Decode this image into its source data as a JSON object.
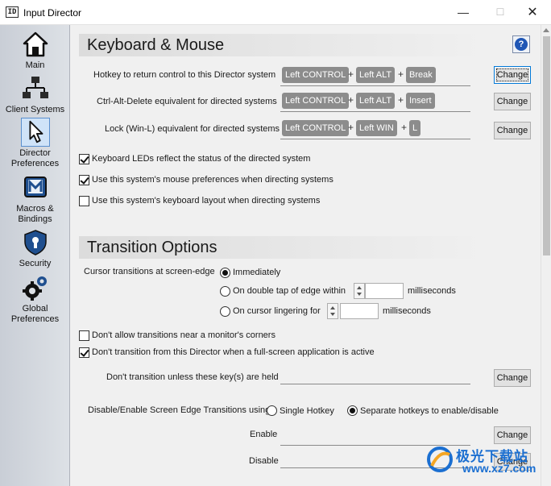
{
  "window": {
    "icon_text": "ID",
    "title": "Input Director",
    "minimize_glyph": "—",
    "maximize_glyph": "☐",
    "close_glyph": "✕"
  },
  "sidebar": {
    "items": [
      {
        "label": "Main",
        "icon": "house-icon"
      },
      {
        "label": "Client Systems",
        "icon": "network-icon"
      },
      {
        "label": "Director Preferences",
        "icon": "cursor-arrow-icon",
        "selected": true
      },
      {
        "label": "Macros & Bindings",
        "icon": "macro-m-icon"
      },
      {
        "label": "Security",
        "icon": "shield-keyhole-icon"
      },
      {
        "label": "Global Preferences",
        "icon": "gears-icon"
      }
    ]
  },
  "keyboard_mouse": {
    "title": "Keyboard & Mouse",
    "help_glyph": "?",
    "hotkey_rows": [
      {
        "label": "Hotkey to return control to this Director system",
        "keys": [
          "Left CONTROL",
          "Left ALT",
          "Break"
        ],
        "button": "Change"
      },
      {
        "label": "Ctrl-Alt-Delete equivalent for directed systems",
        "keys": [
          "Left CONTROL",
          "Left ALT",
          "Insert"
        ],
        "button": "Change"
      },
      {
        "label": "Lock (Win-L) equivalent for directed systems",
        "keys": [
          "Left CONTROL",
          "Left WIN",
          "L"
        ],
        "button": "Change"
      }
    ],
    "plus_glyph": "+",
    "checkboxes": [
      {
        "label": "Keyboard LEDs reflect the status of the directed system",
        "checked": true
      },
      {
        "label": "Use this system's mouse preferences when directing systems",
        "checked": true
      },
      {
        "label": "Use this system's keyboard layout when directing systems",
        "checked": false
      }
    ]
  },
  "transition": {
    "title": "Transition Options",
    "cursor_label": "Cursor transitions at screen-edge",
    "radio_immediately": "Immediately",
    "radio_double_tap": "On double tap of edge within",
    "radio_lingering": "On cursor lingering for",
    "unit_ms": "milliseconds",
    "double_tap_value": "",
    "lingering_value": "",
    "cb_corners": {
      "label": "Don't allow transitions near a monitor's corners",
      "checked": false
    },
    "cb_fullscreen": {
      "label": "Don't transition from this Director when a full-screen application is active",
      "checked": true
    },
    "held_keys_label": "Don't transition unless these key(s) are held",
    "held_keys_button": "Change",
    "disable_enable_label": "Disable/Enable Screen Edge Transitions using",
    "radio_single": "Single Hotkey",
    "radio_separate": "Separate hotkeys to enable/disable",
    "enable_label": "Enable",
    "enable_button": "Change",
    "disable_label": "Disable",
    "disable_button": "Change"
  },
  "watermark": {
    "main": "极光下载站",
    "sub": "www.xz7.com"
  }
}
